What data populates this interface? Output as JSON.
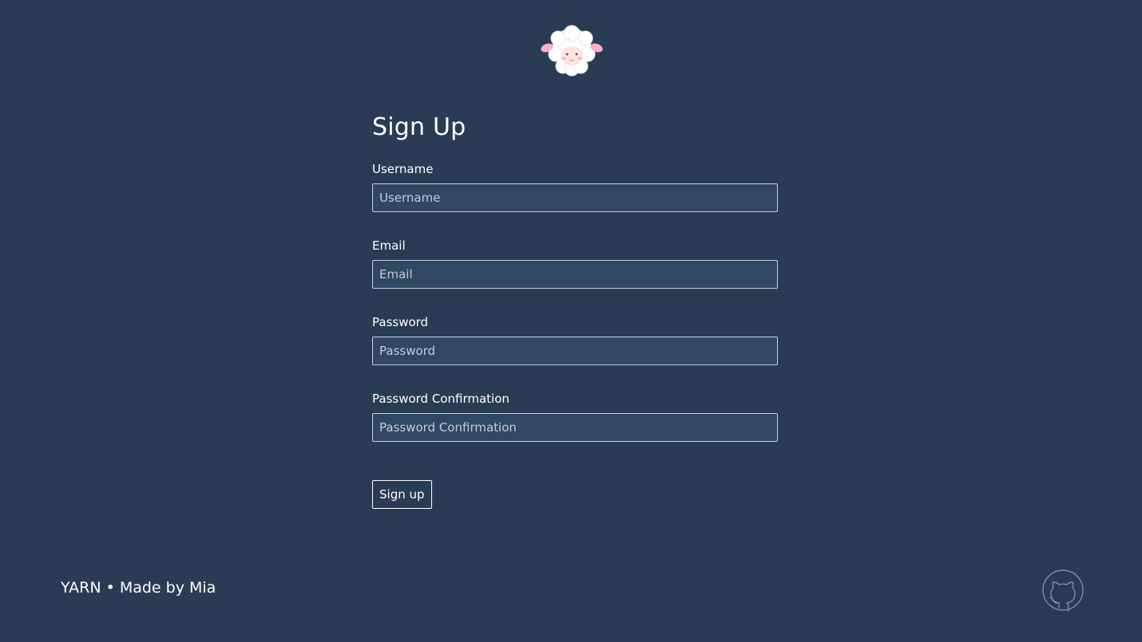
{
  "logo": {
    "icon": "sheep-icon"
  },
  "form": {
    "title": "Sign Up",
    "fields": [
      {
        "label": "Username",
        "placeholder": "Username",
        "value": ""
      },
      {
        "label": "Email",
        "placeholder": "Email",
        "value": ""
      },
      {
        "label": "Password",
        "placeholder": "Password",
        "value": ""
      },
      {
        "label": "Password Confirmation",
        "placeholder": "Password Confirmation",
        "value": ""
      }
    ],
    "submit_label": "Sign up"
  },
  "footer": {
    "text": "YARN • Made by Mia",
    "github_icon": "github-icon"
  },
  "colors": {
    "background": "#293c53",
    "input_background": "#314862",
    "input_border": "#c9d1dc",
    "text": "#ffffff",
    "placeholder": "#c3cbd7"
  }
}
